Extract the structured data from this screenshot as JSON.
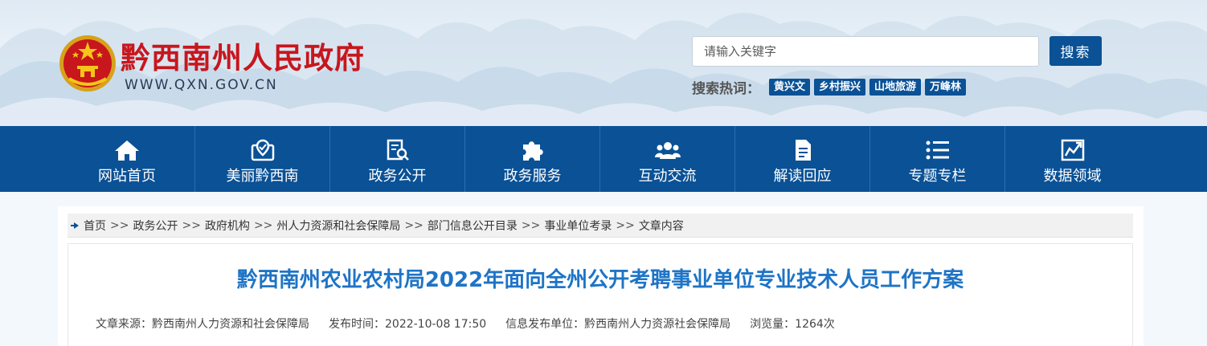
{
  "header": {
    "site_title": "黔西南州人民政府",
    "site_url": "WWW.QXN.GOV.CN",
    "search_placeholder": "请输入关键字",
    "search_button": "搜索",
    "hot_label": "搜索热词：",
    "hot_words": [
      "黄兴文",
      "乡村振兴",
      "山地旅游",
      "万峰林"
    ]
  },
  "nav": [
    {
      "label": "网站首页",
      "icon": "home-icon"
    },
    {
      "label": "美丽黔西南",
      "icon": "map-pin-icon"
    },
    {
      "label": "政务公开",
      "icon": "document-search-icon"
    },
    {
      "label": "政务服务",
      "icon": "puzzle-icon"
    },
    {
      "label": "互动交流",
      "icon": "users-icon"
    },
    {
      "label": "解读回应",
      "icon": "file-icon"
    },
    {
      "label": "专题专栏",
      "icon": "list-icon"
    },
    {
      "label": "数据领域",
      "icon": "chart-icon"
    }
  ],
  "breadcrumb": [
    "首页",
    "政务公开",
    "政府机构",
    "州人力资源和社会保障局",
    "部门信息公开目录",
    "事业单位考录",
    "文章内容"
  ],
  "breadcrumb_sep": ">>",
  "article": {
    "title": "黔西南州农业农村局2022年面向全州公开考聘事业单位专业技术人员工作方案",
    "source": "文章来源：黔西南州人力资源和社会保障局",
    "publish_time": "发布时间：2022-10-08 17:50",
    "publisher": "信息发布单位：黔西南州人力资源社会保障局",
    "views": "浏览量：1264次"
  },
  "colors": {
    "primary": "#0a5196",
    "title_red": "#c8161d",
    "article_title": "#1e74c6"
  }
}
